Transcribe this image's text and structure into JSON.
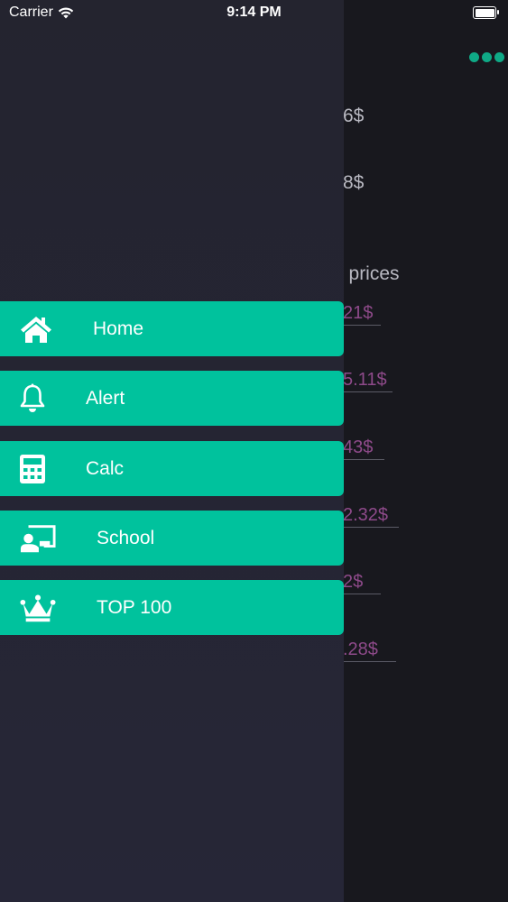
{
  "status_bar": {
    "carrier": "Carrier",
    "time": "9:14 PM"
  },
  "background": {
    "partial_values": [
      "6$",
      "8$"
    ],
    "section_label": "e prices",
    "partial_prices": [
      "21$",
      "5.11$",
      "43$",
      "2.32$",
      "2$",
      ".28$"
    ]
  },
  "menu": {
    "items": [
      {
        "label": "Home",
        "icon": "home-icon"
      },
      {
        "label": "Alert",
        "icon": "bell-icon"
      },
      {
        "label": "Calc",
        "icon": "calculator-icon"
      },
      {
        "label": "School",
        "icon": "school-icon"
      },
      {
        "label": "TOP 100",
        "icon": "crown-icon"
      }
    ]
  },
  "colors": {
    "accent": "#00c29d",
    "drawer": "#24242f",
    "background": "#18181e",
    "price_text": "#8e4a8a"
  }
}
